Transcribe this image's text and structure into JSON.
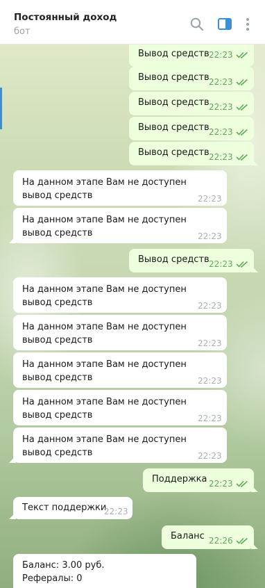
{
  "header": {
    "title": "Постоянный доход",
    "subtitle": "бот"
  },
  "icons": {
    "search": "search-icon",
    "sidebar": "sidebar-toggle-icon",
    "menu": "more-vertical-icon",
    "read": "double-check-icon"
  },
  "colors": {
    "outgoing_bubble": "#eeffde",
    "incoming_bubble": "#ffffff",
    "outgoing_time": "#5faa5c",
    "accent": "#3a8fd6"
  },
  "messages": [
    {
      "dir": "out",
      "text": "Вывод средств",
      "time": "22:23",
      "read": true
    },
    {
      "dir": "out",
      "text": "Вывод средств",
      "time": "22:23",
      "read": true
    },
    {
      "dir": "out",
      "text": "Вывод средств",
      "time": "22:23",
      "read": true
    },
    {
      "dir": "out",
      "text": "Вывод средств",
      "time": "22:23",
      "read": true
    },
    {
      "dir": "out",
      "text": "Вывод средств",
      "time": "22:23",
      "read": true
    },
    {
      "dir": "in",
      "text": "На данном этапе Вам не доступен вывод средств",
      "time": "22:23"
    },
    {
      "dir": "in",
      "text": "На данном этапе Вам не доступен вывод средств",
      "time": "22:23"
    },
    {
      "dir": "out",
      "text": "Вывод средств",
      "time": "22:23",
      "read": true
    },
    {
      "dir": "in",
      "text": "На данном этапе Вам не доступен вывод средств",
      "time": "22:23"
    },
    {
      "dir": "in",
      "text": "На данном этапе Вам не доступен вывод средств",
      "time": "22:23"
    },
    {
      "dir": "in",
      "text": "На данном этапе Вам не доступен вывод средств",
      "time": "22:23"
    },
    {
      "dir": "in",
      "text": "На данном этапе Вам не доступен вывод средств",
      "time": "22:23"
    },
    {
      "dir": "in",
      "text": "На данном этапе Вам не доступен вывод средств",
      "time": "22:23"
    },
    {
      "dir": "out",
      "text": "Поддержка",
      "time": "22:23",
      "read": true
    },
    {
      "dir": "in",
      "text": "Текст поддержки",
      "time": "22:23"
    },
    {
      "dir": "out",
      "text": "Баланс",
      "time": "22:26",
      "read": true
    },
    {
      "dir": "in",
      "lines": [
        "Баланс: 3.00 руб.",
        "Рефералы: 0"
      ]
    }
  ]
}
